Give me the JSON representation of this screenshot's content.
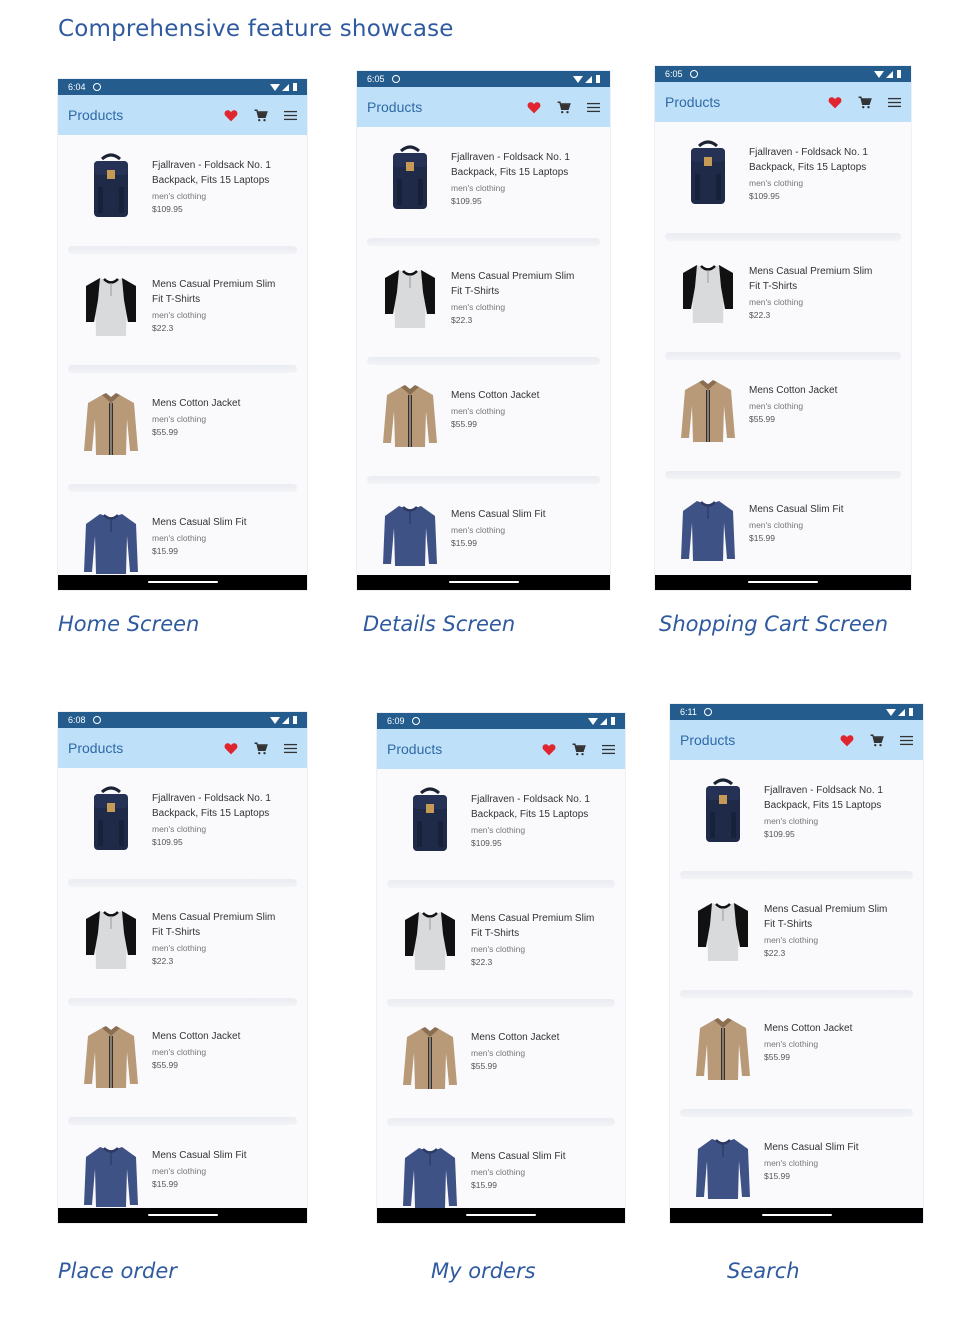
{
  "page_title": "Comprehensive feature showcase",
  "app": {
    "title": "Products",
    "products": [
      {
        "name_lines": [
          "Fjallraven - Foldsack No. 1",
          "Backpack, Fits 15 Laptops"
        ],
        "category": "men's clothing",
        "price": "$109.95",
        "icon": "backpack"
      },
      {
        "name_lines": [
          "Mens Casual Premium Slim",
          "Fit T-Shirts"
        ],
        "category": "men's clothing",
        "price": "$22.3",
        "icon": "tshirt"
      },
      {
        "name_lines": [
          "Mens Cotton Jacket"
        ],
        "category": "men's clothing",
        "price": "$55.99",
        "icon": "jacket"
      },
      {
        "name_lines": [
          "Mens Casual Slim Fit"
        ],
        "category": "men's clothing",
        "price": "$15.99",
        "icon": "longsleeve"
      }
    ]
  },
  "screens": [
    {
      "time": "6:04",
      "caption": "Home Screen"
    },
    {
      "time": "6:05",
      "caption": "Details Screen"
    },
    {
      "time": "6:05",
      "caption": "Shopping Cart Screen"
    },
    {
      "time": "6:08",
      "caption": "Place order"
    },
    {
      "time": "6:09",
      "caption": "My orders"
    },
    {
      "time": "6:11",
      "caption": "Search"
    }
  ],
  "colors": {
    "status_bar": "#245d8d",
    "app_bar": "#bfe0f9",
    "title": "#2f6aa6",
    "heart": "#e0252e",
    "caption": "#2f5aa0"
  }
}
